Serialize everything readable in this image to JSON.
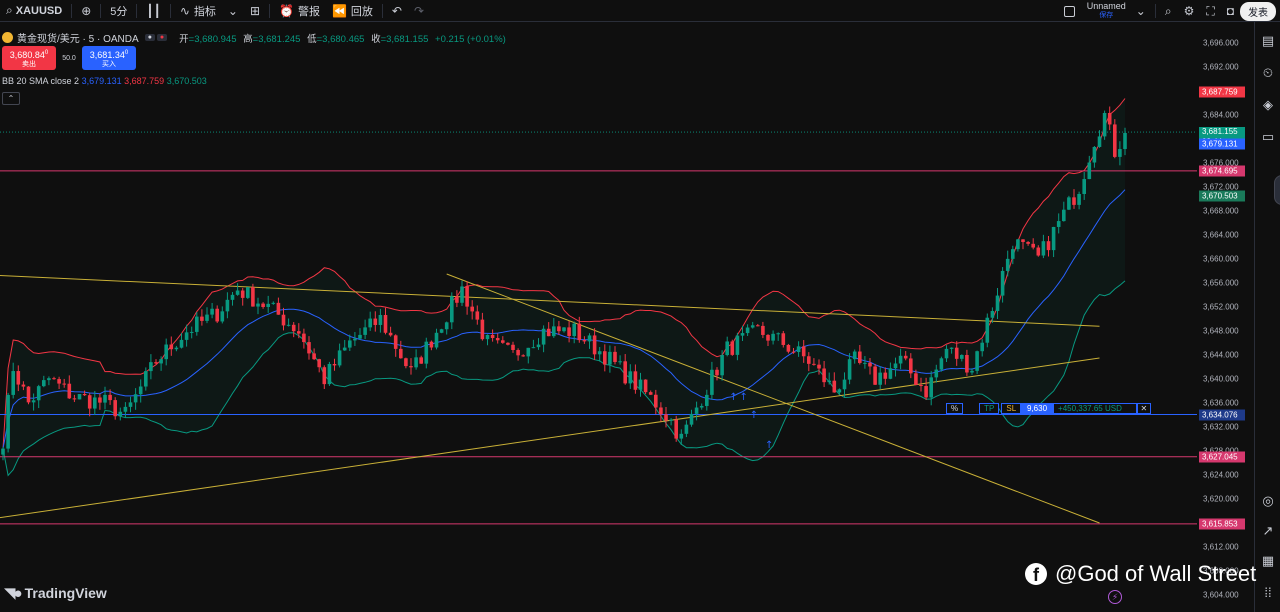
{
  "toolbar": {
    "symbol": "XAUUSD",
    "interval": "5分",
    "indicators_label": "指标",
    "alerts_label": "警报",
    "replay_label": "回放",
    "layout_name": "Unnamed",
    "layout_status": "保存",
    "publish_label": "发表"
  },
  "legend": {
    "title": "黄金现货/美元 · 5 · OANDA",
    "open_label": "开",
    "open": "=3,680.945",
    "high_label": "高",
    "high": "=3,681.245",
    "low_label": "低",
    "low": "=3,680.465",
    "close_label": "收",
    "close": "=3,681.155",
    "change": "+0.215 (+0.01%)"
  },
  "trade": {
    "sell_price": "3,680.84",
    "sell_sup": "0",
    "sell_label": "卖出",
    "spread": "50.0",
    "buy_price": "3,681.34",
    "buy_sup": "0",
    "buy_label": "买入"
  },
  "bb": {
    "name": "BB 20 SMA close 2",
    "basis": "3,679.131",
    "upper": "3,687.759",
    "lower": "3,670.503"
  },
  "price_axis": {
    "ticks": [
      "3,696.000",
      "3,692.000",
      "3,684.000",
      "3,680.000",
      "3,676.000",
      "3,672.000",
      "3,668.000",
      "3,664.000",
      "3,660.000",
      "3,656.000",
      "3,652.000",
      "3,648.000",
      "3,644.000",
      "3,640.000",
      "3,636.000",
      "3,632.000",
      "3,628.000",
      "3,624.000",
      "3,620.000",
      "3,616.000",
      "3,612.000",
      "3,608.000",
      "3,604.000"
    ],
    "labels": {
      "bb_upper": "3,687.759",
      "current_price": "3,681.155",
      "countdown": "03:44",
      "bb_basis": "3,679.131",
      "hline_1": "3,674.695",
      "bb_lower": "3,670.503",
      "order_line": "3,634.076",
      "hline_2": "3,627.045",
      "hline_3": "3,615.853"
    }
  },
  "order": {
    "percent_label": "%",
    "tp_label": "TP",
    "sl_label": "SL",
    "quantity": "9,630",
    "pnl": "+450,337.65 USD",
    "close_symbol": "✕"
  },
  "watermark": {
    "tradingview": "TradingView",
    "facebook": "@God of Wall Street"
  },
  "colors": {
    "bull": "#089981",
    "bear": "#f23645",
    "bb_basis": "#2962ff",
    "bb_upper": "#f23645",
    "bb_lower": "#089981",
    "trendline": "#c9b037",
    "hline": "#d6386e",
    "order_line": "#2962ff"
  },
  "chart_data": {
    "type": "candlestick",
    "price_range": [
      3602,
      3700
    ],
    "bb_period": 20,
    "bb_mult": 2,
    "anchors": [
      [
        0,
        3630
      ],
      [
        2,
        3642
      ],
      [
        5,
        3636
      ],
      [
        9,
        3640
      ],
      [
        14,
        3637
      ],
      [
        20,
        3636
      ],
      [
        24,
        3634
      ],
      [
        30,
        3643
      ],
      [
        36,
        3648
      ],
      [
        42,
        3651
      ],
      [
        46,
        3655
      ],
      [
        52,
        3652
      ],
      [
        58,
        3648
      ],
      [
        63,
        3640
      ],
      [
        68,
        3646
      ],
      [
        74,
        3650
      ],
      [
        80,
        3641
      ],
      [
        85,
        3648
      ],
      [
        90,
        3655
      ],
      [
        95,
        3646
      ],
      [
        100,
        3644
      ],
      [
        106,
        3648
      ],
      [
        112,
        3648
      ],
      [
        118,
        3644
      ],
      [
        123,
        3640
      ],
      [
        128,
        3636
      ],
      [
        131,
        3633
      ],
      [
        133,
        3630
      ],
      [
        137,
        3637
      ],
      [
        142,
        3645
      ],
      [
        148,
        3648
      ],
      [
        153,
        3646
      ],
      [
        158,
        3643
      ],
      [
        163,
        3638
      ],
      [
        167,
        3643
      ],
      [
        171,
        3640
      ],
      [
        176,
        3643
      ],
      [
        181,
        3638
      ],
      [
        185,
        3645
      ],
      [
        190,
        3642
      ],
      [
        194,
        3652
      ],
      [
        198,
        3663
      ],
      [
        203,
        3660
      ],
      [
        207,
        3666
      ],
      [
        211,
        3672
      ],
      [
        214,
        3680
      ],
      [
        216,
        3684
      ],
      [
        218,
        3678
      ],
      [
        220,
        3681
      ]
    ],
    "trendlines": [
      {
        "from": [
          -20,
          3658.0
        ],
        "to": [
          215,
          3648.8
        ]
      },
      {
        "from": [
          -20,
          3614.5
        ],
        "to": [
          215,
          3643.5
        ]
      },
      {
        "from": [
          87,
          3657.5
        ],
        "to": [
          215,
          3616.0
        ]
      }
    ],
    "hlines": [
      3674.695,
      3627.045,
      3615.853
    ],
    "order_line": 3634.076,
    "current_price": 3681.155
  }
}
